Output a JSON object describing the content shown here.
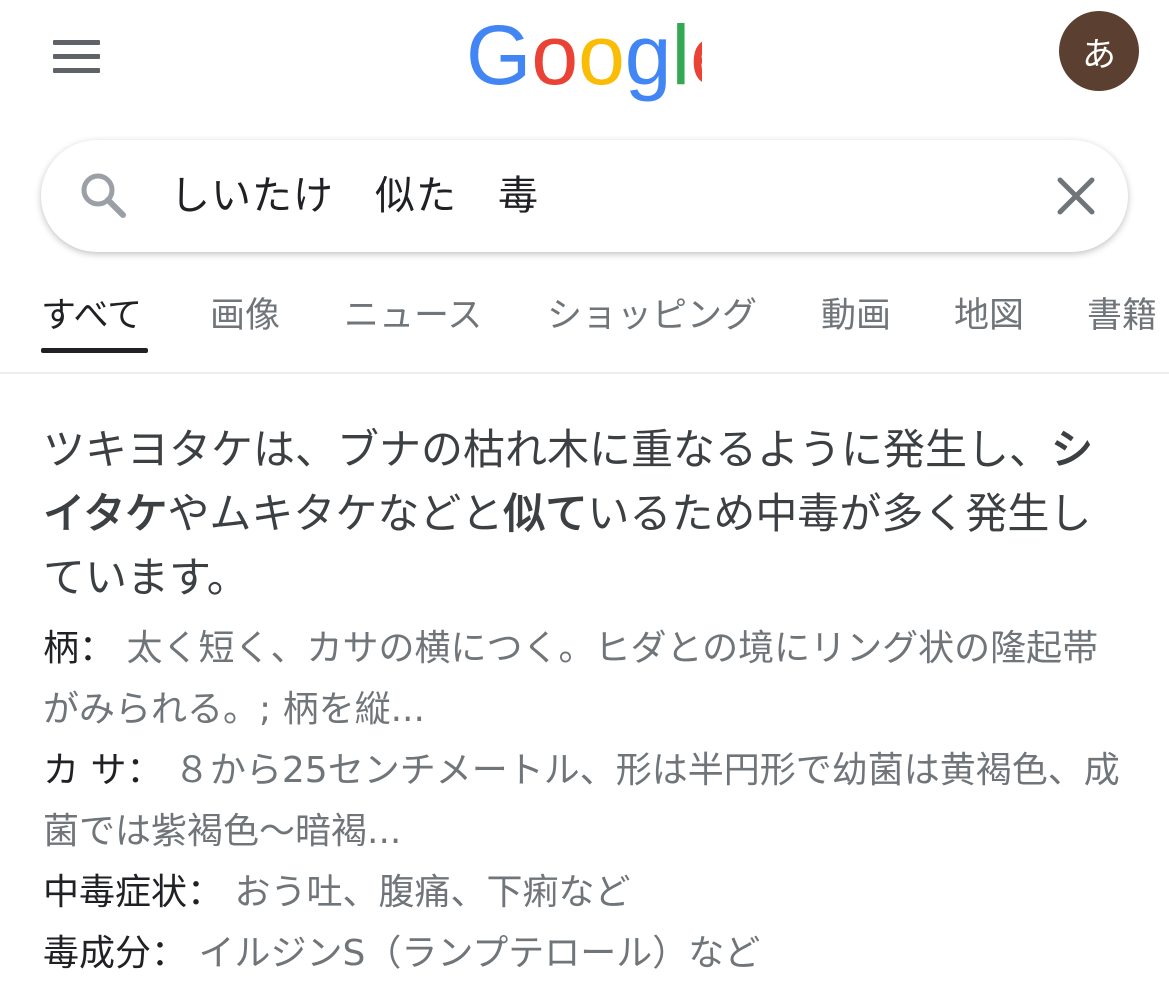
{
  "header": {
    "logo_text": "Google",
    "avatar_letter": "あ"
  },
  "search": {
    "query": "しいたけ　似た　毒"
  },
  "tabs": [
    {
      "label": "すべて",
      "active": true
    },
    {
      "label": "画像"
    },
    {
      "label": "ニュース"
    },
    {
      "label": "ショッピング"
    },
    {
      "label": "動画"
    },
    {
      "label": "地図"
    },
    {
      "label": "書籍"
    }
  ],
  "answer": {
    "part1": "ツキヨタケは、ブナの枯れ木に重なるように発生し、",
    "bold1": "シイタケ",
    "part2": "やムキタケなどと",
    "bold2": "似て",
    "part3": "いるため中毒が多く発生しています。"
  },
  "facts": [
    {
      "label": "柄：",
      "value": "太く短く、カサの横につく。ヒダとの境にリング状の隆起帯がみられる。; 柄を縦..."
    },
    {
      "label": "カ サ：",
      "value": "８から25センチメートル、形は半円形で幼菌は黄褐色、成菌では紫褐色～暗褐..."
    },
    {
      "label": "中毒症状：",
      "value": "おう吐、腹痛、下痢など"
    },
    {
      "label": "毒成分：",
      "value": "イルジンS（ランプテロール）など"
    }
  ],
  "colors": {
    "google_blue": "#4285F4",
    "google_red": "#EA4335",
    "google_yellow": "#FBBC05",
    "google_green": "#34A853",
    "avatar_bg": "#5b4031"
  }
}
